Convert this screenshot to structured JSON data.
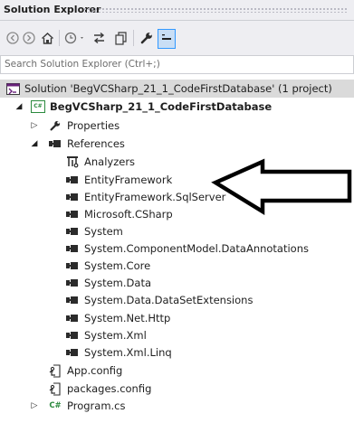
{
  "window": {
    "title": "Solution Explorer"
  },
  "toolbar": {
    "buttons": [
      "back-icon",
      "forward-icon",
      "home-icon",
      "pending-changes-icon",
      "sync-icon",
      "show-all-files-icon",
      "properties-icon",
      "collapse-icon"
    ]
  },
  "search": {
    "placeholder": "Search Solution Explorer (Ctrl+;)"
  },
  "tree": {
    "solution": "Solution 'BegVCSharp_21_1_CodeFirstDatabase' (1 project)",
    "project": "BegVCSharp_21_1_CodeFirstDatabase",
    "properties": "Properties",
    "references": "References",
    "analyzers": "Analyzers",
    "refs": [
      "EntityFramework",
      "EntityFramework.SqlServer",
      "Microsoft.CSharp",
      "System",
      "System.ComponentModel.DataAnnotations",
      "System.Core",
      "System.Data",
      "System.Data.DataSetExtensions",
      "System.Net.Http",
      "System.Xml",
      "System.Xml.Linq"
    ],
    "app_config": "App.config",
    "packages_config": "packages.config",
    "program": "Program.cs"
  },
  "icons": {
    "project": "C#",
    "cs_file": "C#"
  },
  "colors": {
    "selection": "#dadada",
    "accent": "#3399ff",
    "csharp": "#2b8a3e"
  }
}
